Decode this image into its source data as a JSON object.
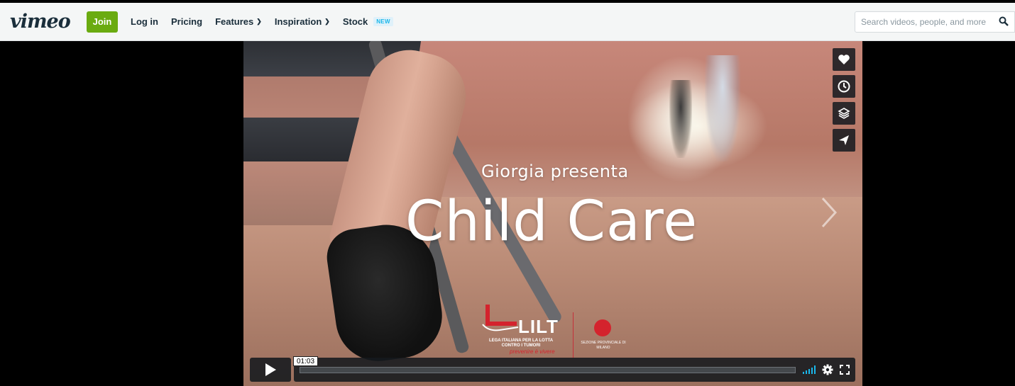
{
  "nav": {
    "logo": "vimeo",
    "join": "Join",
    "items": [
      {
        "label": "Log in",
        "chevron": false
      },
      {
        "label": "Pricing",
        "chevron": false
      },
      {
        "label": "Features",
        "chevron": true
      },
      {
        "label": "Inspiration",
        "chevron": true
      },
      {
        "label": "Stock",
        "chevron": false
      }
    ],
    "stock_badge": "NEW",
    "search_placeholder": "Search videos, people, and more"
  },
  "video": {
    "presenter_line": "Giorgia presenta",
    "title": "Child Care",
    "logo_name": "LILT",
    "logo_subtitle": "LEGA ITALIANA PER LA LOTTA CONTRO I TUMORI",
    "logo_tagline": "prevenire è vivere",
    "sezione_text": "SEZIONE PROVINCIALE DI MILANO"
  },
  "side_actions": [
    {
      "name": "like",
      "icon": "heart-icon"
    },
    {
      "name": "watch-later",
      "icon": "clock-icon"
    },
    {
      "name": "collections",
      "icon": "layers-icon"
    },
    {
      "name": "share",
      "icon": "send-icon"
    }
  ],
  "player": {
    "time": "01:03",
    "progress": 0.0,
    "accent": "#1ab7ea"
  },
  "colors": {
    "brand_green": "#6aab10",
    "accent_blue": "#1ab7ea",
    "nav_text": "#1a2e3b"
  }
}
